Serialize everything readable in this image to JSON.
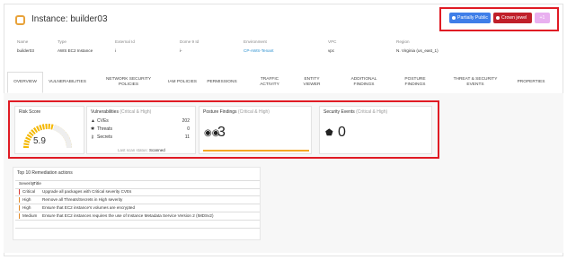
{
  "header": {
    "title": "Instance: builder03",
    "btn_public": "Partially Public",
    "btn_crown": "Crown jewel",
    "btn_pink": "+1"
  },
  "meta": [
    {
      "label": "Name",
      "value": "builder03",
      "link": false
    },
    {
      "label": "Type",
      "value": "AWS EC2 Instance",
      "link": false
    },
    {
      "label": "External Id",
      "value": "i",
      "link": false
    },
    {
      "label": "Dome 9 Id",
      "value": "i-",
      "link": false
    },
    {
      "label": "Environment",
      "value": "CP-AWS-Tenant",
      "link": true
    },
    {
      "label": "VPC",
      "value": "vpc",
      "link": false
    },
    {
      "label": "Region",
      "value": "N. Virginia (us_east_1)",
      "link": false
    }
  ],
  "tabs": [
    "OVERVIEW",
    "VULNERABILITIES",
    "NETWORK SECURITY POLICIES",
    "IAM POLICIES",
    "PERMISSIONS",
    "TRAFFIC ACTIVITY",
    "ENTITY VIEWER",
    "ADDITIONAL FINDINGS",
    "POSTURE FINDINGS",
    "THREAT & SECURITY EVENTS",
    "PROPERTIES"
  ],
  "risk": {
    "title": "Risk Score",
    "score": "5.9",
    "gauge_fraction": 0.59
  },
  "vulns": {
    "title": "Vulnerabilities",
    "sub": "(Critical & High)",
    "rows": [
      {
        "label": "CVEs",
        "count": "202"
      },
      {
        "label": "Threats",
        "count": "0"
      },
      {
        "label": "Secrets",
        "count": "11"
      }
    ],
    "last_scan_label": "Last scan status:",
    "last_scan_value": "Scanned"
  },
  "posture": {
    "title": "Posture Findings",
    "sub": "(Critical & High)",
    "value": "3"
  },
  "events": {
    "title": "Security Events",
    "sub": "(Critical & High)",
    "value": "0"
  },
  "remediation": {
    "title": "Top 10 Remediation actions",
    "col_severity": "Severity",
    "col_title": "Title",
    "rows": [
      {
        "severity": "Critical",
        "title": "Upgrade all packages with Critical severity CVEs"
      },
      {
        "severity": "High",
        "title": "Remove all Threats/Secrets in High severity"
      },
      {
        "severity": "High",
        "title": "Ensure that EC2 instance's volumes are encrypted"
      },
      {
        "severity": "Medium",
        "title": "Ensure that EC2 instances requires the use of Instance Metadata Service Version 2 (IMDSv2)"
      }
    ]
  },
  "colors": {
    "highlight": "#e01b24",
    "gauge": "#f5b800",
    "link": "#2a8fcf"
  }
}
